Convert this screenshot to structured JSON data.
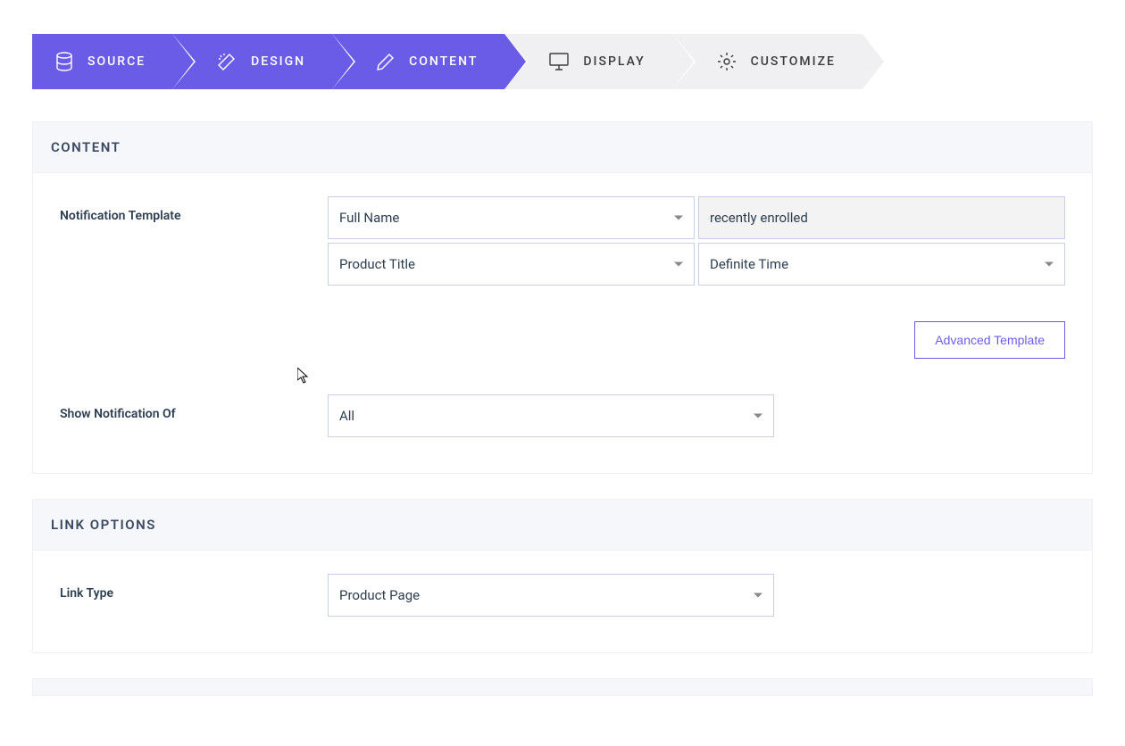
{
  "stepper": [
    {
      "label": "SOURCE",
      "icon": "database",
      "active": true
    },
    {
      "label": "DESIGN",
      "icon": "wand",
      "active": true
    },
    {
      "label": "CONTENT",
      "icon": "pencil",
      "active": true
    },
    {
      "label": "DISPLAY",
      "icon": "monitor",
      "active": false
    },
    {
      "label": "CUSTOMIZE",
      "icon": "gear",
      "active": false
    }
  ],
  "sections": {
    "content": {
      "title": "CONTENT",
      "fields": {
        "notification_template": {
          "label": "Notification Template",
          "var1": "Full Name",
          "text": "recently enrolled",
          "var2": "Product Title",
          "var3": "Definite Time",
          "advanced_btn": "Advanced Template"
        },
        "show_notification_of": {
          "label": "Show Notification Of",
          "value": "All"
        }
      }
    },
    "link_options": {
      "title": "LINK OPTIONS",
      "fields": {
        "link_type": {
          "label": "Link Type",
          "value": "Product Page"
        }
      }
    }
  }
}
